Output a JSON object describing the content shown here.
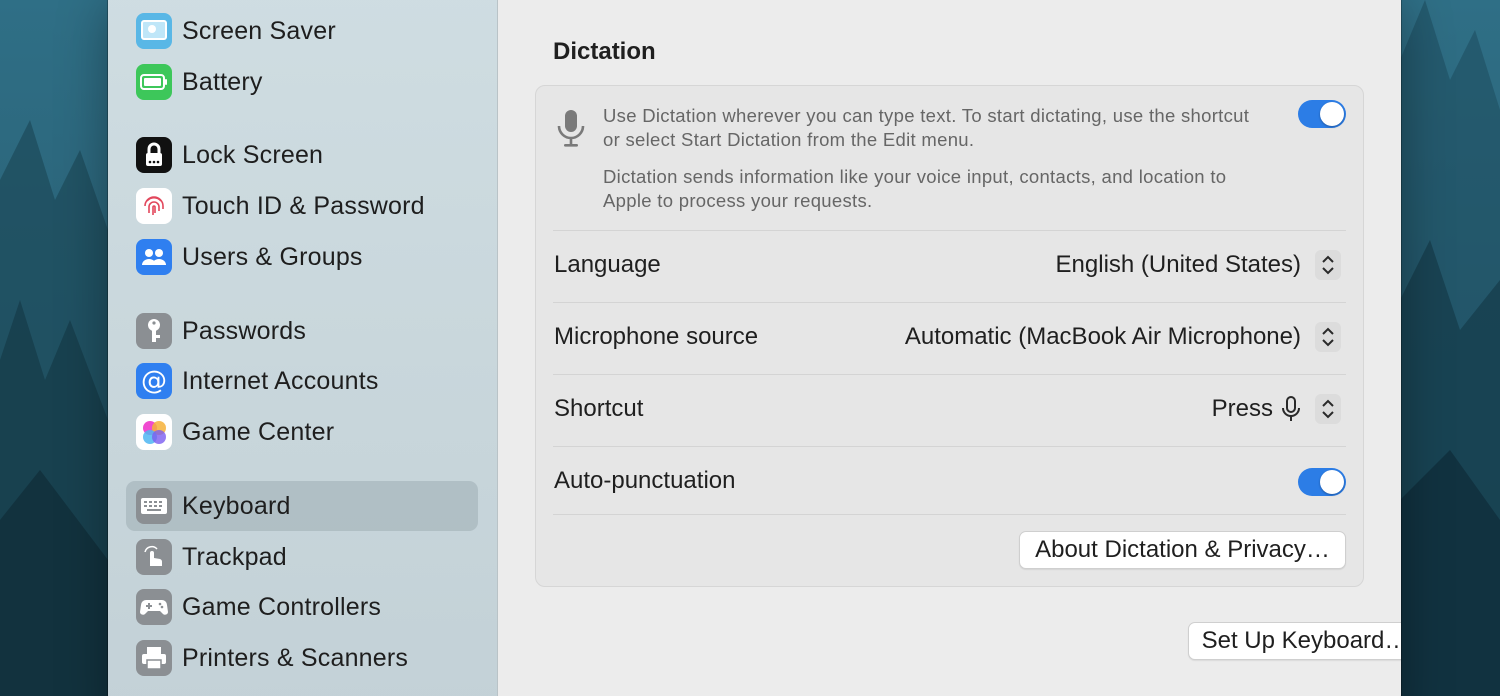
{
  "sidebar": {
    "items": [
      {
        "label": "Screen Saver",
        "icon": "screen-saver-icon",
        "color": "#59b7e6"
      },
      {
        "label": "Battery",
        "icon": "battery-icon",
        "color": "#3dc75a"
      },
      {
        "label": "Lock Screen",
        "icon": "lock-icon",
        "color": "#111111"
      },
      {
        "label": "Touch ID & Password",
        "icon": "fingerprint-icon",
        "color": "#ffffff"
      },
      {
        "label": "Users & Groups",
        "icon": "users-icon",
        "color": "#2f7ff0"
      },
      {
        "label": "Passwords",
        "icon": "key-icon",
        "color": "#8b8f93"
      },
      {
        "label": "Internet Accounts",
        "icon": "at-icon",
        "color": "#2f7ff0"
      },
      {
        "label": "Game Center",
        "icon": "game-center-icon",
        "color": "#ffffff"
      },
      {
        "label": "Keyboard",
        "icon": "keyboard-icon",
        "color": "#8b8f93",
        "selected": true
      },
      {
        "label": "Trackpad",
        "icon": "trackpad-icon",
        "color": "#8b8f93"
      },
      {
        "label": "Game Controllers",
        "icon": "game-controller-icon",
        "color": "#8b8f93"
      },
      {
        "label": "Printers & Scanners",
        "icon": "printer-icon",
        "color": "#8b8f93"
      }
    ]
  },
  "dictation": {
    "title": "Dictation",
    "description": [
      "Use Dictation wherever you can type text. To start dictating, use the shortcut",
      "or select Start Dictation from the Edit menu."
    ],
    "privacy_note": [
      "Dictation sends information like your voice input, contacts, and location to",
      "Apple to process your requests."
    ],
    "enabled": true,
    "rows": {
      "language": {
        "label": "Language",
        "value": "English (United States)"
      },
      "microphone": {
        "label": "Microphone source",
        "value": "Automatic (MacBook Air Microphone)"
      },
      "shortcut": {
        "label": "Shortcut",
        "value": "Press"
      },
      "auto_punctuation": {
        "label": "Auto-punctuation",
        "enabled": true
      }
    },
    "about_button": "About Dictation & Privacy…"
  },
  "footer": {
    "setup_button": "Set Up Keyboard…",
    "help_label": "?"
  },
  "colors": {
    "accent": "#2c7de6",
    "wallpaper": "#2f6f86"
  }
}
